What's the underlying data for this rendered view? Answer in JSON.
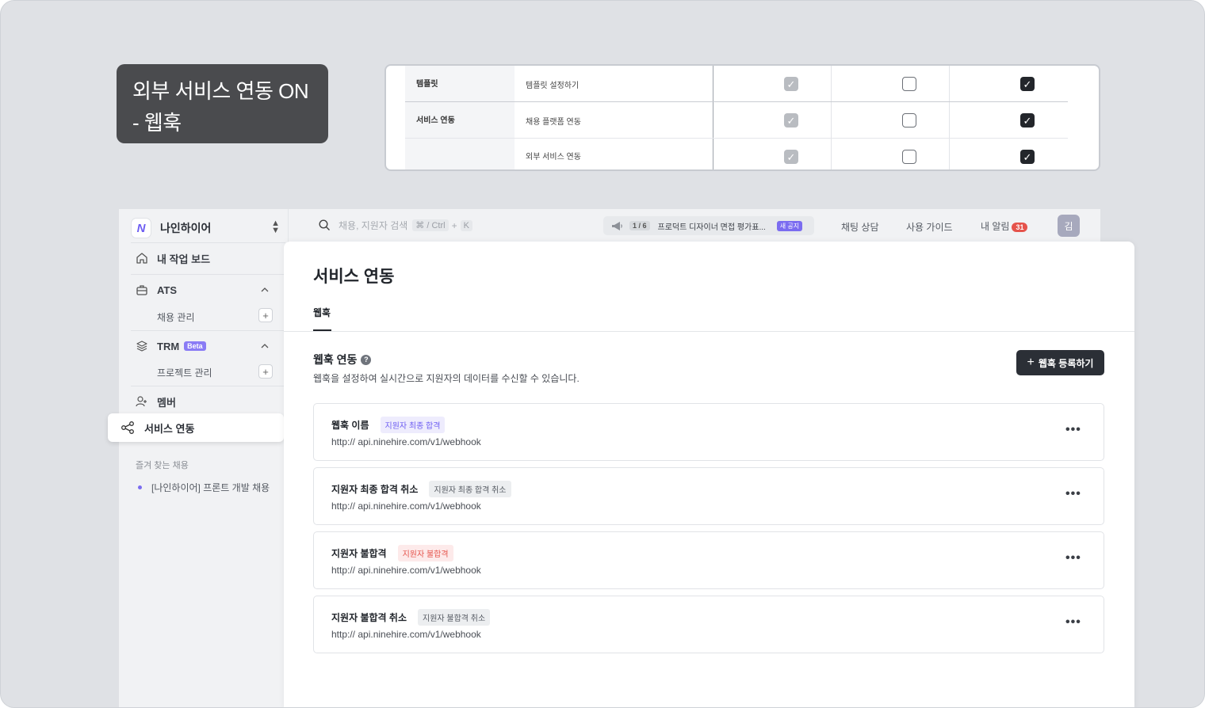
{
  "label_card": {
    "line1": "외부 서비스 연동 ON",
    "line2": "- 웹훅"
  },
  "permission_table": {
    "rows": [
      {
        "category": "템플릿",
        "item": "템플릿 설정하기"
      },
      {
        "category": "서비스 연동",
        "item": "채용 플랫폼 연동"
      },
      {
        "category": "",
        "item": "외부 서비스 연동"
      }
    ],
    "column_states": [
      "checked-disabled",
      "unchecked",
      "checked"
    ]
  },
  "sidebar": {
    "workspace": "나인하이어",
    "logo_glyph": "N",
    "dashboard": "내 작업 보드",
    "ats": "ATS",
    "ats_sub": "채용 관리",
    "trm": "TRM",
    "trm_badge": "Beta",
    "trm_sub": "프로젝트 관리",
    "member": "멤버",
    "service": "서비스 연동",
    "fav_title": "즐겨 찾는 채용",
    "fav_item": "[나인하이어] 프론트 개발 채용"
  },
  "topbar": {
    "search_placeholder": "채용, 지원자 검색",
    "kbd1": "⌘ / Ctrl",
    "kbd_plus": "+",
    "kbd2": "K",
    "notice_count": "1 / 6",
    "notice_text": "프로덕트 디자이너 면접 평가표...",
    "notice_badge": "새 공지",
    "chat": "채팅 상담",
    "guide": "사용 가이드",
    "alarm": "내 알림",
    "alarm_count": "31",
    "avatar": "김"
  },
  "main": {
    "title": "서비스 연동",
    "tab": "웹훅",
    "section_title": "웹훅 연동",
    "help": "?",
    "section_desc": "웹훅을 설정하여 실시간으로 지원자의 데이터를 수신할 수 있습니다.",
    "add_button": "웹훅 등록하기",
    "webhooks": [
      {
        "name": "웹훅 이름",
        "tag": "지원자 최종 합격",
        "url": "http:// api.ninehire.com/v1/webhook"
      },
      {
        "name": "지원자 최종 합격 취소",
        "tag": "지원자 최종 합격 취소",
        "url": "http:// api.ninehire.com/v1/webhook"
      },
      {
        "name": "지원자 불합격",
        "tag": "지원자 불합격",
        "url": "http:// api.ninehire.com/v1/webhook"
      },
      {
        "name": "지원자 불합격 취소",
        "tag": "지원자 불합격 취소",
        "url": "http:// api.ninehire.com/v1/webhook"
      }
    ]
  },
  "colors": {
    "accent": "#6d5df2",
    "dark": "#2b2f36",
    "danger": "#e5534b"
  }
}
